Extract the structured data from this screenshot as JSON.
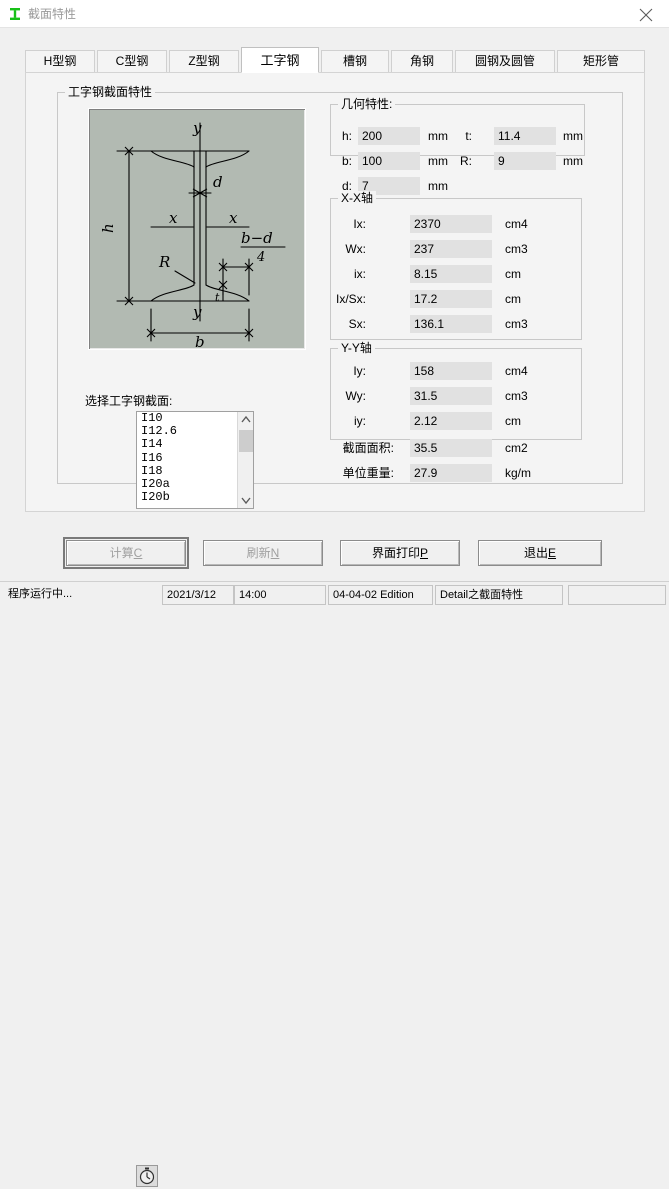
{
  "window": {
    "title": "截面特性",
    "icon": "i-beam-icon",
    "close_label": "×"
  },
  "tabs": [
    {
      "label": "H型钢",
      "active": false
    },
    {
      "label": "C型钢",
      "active": false
    },
    {
      "label": "Z型钢",
      "active": false
    },
    {
      "label": "工字钢",
      "active": true
    },
    {
      "label": "槽钢",
      "active": false
    },
    {
      "label": "角钢",
      "active": false
    },
    {
      "label": "圆钢及圆管",
      "active": false
    },
    {
      "label": "矩形管",
      "active": false
    }
  ],
  "main_group": {
    "legend": "工字钢截面特性"
  },
  "diagram": {
    "background_color": "#b2bab2",
    "labels": {
      "y_top": "y",
      "y_bottom": "y",
      "x_left": "x",
      "x_right": "x",
      "height": "h",
      "width": "b",
      "web": "d",
      "radius": "R",
      "flange": "t",
      "fraction_numerator": "b−d",
      "fraction_denominator": "4"
    }
  },
  "selector": {
    "label": "选择工字钢截面:",
    "items": [
      "I10",
      "I12.6",
      "I14",
      "I16",
      "I18",
      "I20a",
      "I20b"
    ]
  },
  "geometry": {
    "legend": "几何特性:",
    "rows": [
      {
        "label": "h:",
        "value": "200",
        "unit": "mm"
      },
      {
        "label": "t:",
        "value": "11.4",
        "unit": "mm"
      },
      {
        "label": "b:",
        "value": "100",
        "unit": "mm"
      },
      {
        "label": "R:",
        "value": "9",
        "unit": "mm"
      },
      {
        "label": "d:",
        "value": "7",
        "unit": "mm"
      }
    ]
  },
  "xx_axis": {
    "legend": "X-X轴",
    "rows": [
      {
        "label": "Ix:",
        "value": "2370",
        "unit": "cm4"
      },
      {
        "label": "Wx:",
        "value": "237",
        "unit": "cm3"
      },
      {
        "label": "ix:",
        "value": "8.15",
        "unit": "cm"
      },
      {
        "label": "Ix/Sx:",
        "value": "17.2",
        "unit": "cm"
      },
      {
        "label": "Sx:",
        "value": "136.1",
        "unit": "cm3"
      }
    ]
  },
  "yy_axis": {
    "legend": "Y-Y轴",
    "rows": [
      {
        "label": "Iy:",
        "value": "158",
        "unit": "cm4"
      },
      {
        "label": "Wy:",
        "value": "31.5",
        "unit": "cm3"
      },
      {
        "label": "iy:",
        "value": "2.12",
        "unit": "cm"
      }
    ]
  },
  "summary": {
    "rows": [
      {
        "label": "截面面积:",
        "value": "35.5",
        "unit": "cm2"
      },
      {
        "label": "单位重量:",
        "value": "27.9",
        "unit": "kg/m"
      }
    ]
  },
  "buttons": [
    {
      "name": "calculate-button",
      "text": "计算",
      "mnemonic": "C",
      "disabled": true,
      "focused": true
    },
    {
      "name": "refresh-button",
      "text": "刷新",
      "mnemonic": "N",
      "disabled": true,
      "focused": false
    },
    {
      "name": "print-button",
      "text": "界面打印",
      "mnemonic": "P",
      "disabled": false,
      "focused": false
    },
    {
      "name": "exit-button",
      "text": "退出",
      "mnemonic": "E",
      "disabled": false,
      "focused": false
    }
  ],
  "statusbar": {
    "message": "程序运行中...",
    "date": "2021/3/12",
    "time": "14:00",
    "edition": "04-04-02 Edition",
    "module": "Detail之截面特性",
    "extra": ""
  }
}
